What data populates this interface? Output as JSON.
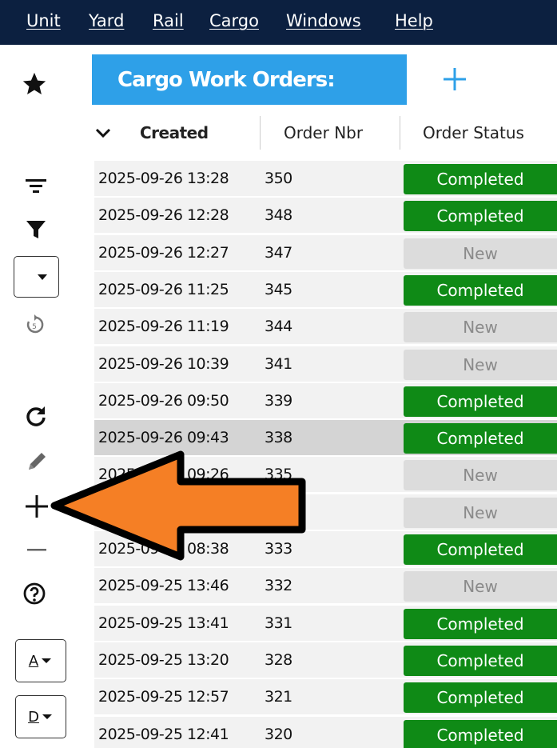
{
  "menu": [
    "Unit",
    "Yard",
    "Rail",
    "Cargo",
    "Windows",
    "Help"
  ],
  "toolbar": {
    "sort_a_label": "A",
    "sort_d_label": "D"
  },
  "title": "Cargo Work Orders:",
  "table": {
    "columns": [
      "Created",
      "Order Nbr",
      "Order Status"
    ],
    "rows": [
      {
        "created": "2025-09-26 13:28",
        "order_nbr": "350",
        "status": "Completed"
      },
      {
        "created": "2025-09-26 12:28",
        "order_nbr": "348",
        "status": "Completed"
      },
      {
        "created": "2025-09-26 12:27",
        "order_nbr": "347",
        "status": "New"
      },
      {
        "created": "2025-09-26 11:25",
        "order_nbr": "345",
        "status": "Completed"
      },
      {
        "created": "2025-09-26 11:19",
        "order_nbr": "344",
        "status": "New"
      },
      {
        "created": "2025-09-26 10:39",
        "order_nbr": "341",
        "status": "New"
      },
      {
        "created": "2025-09-26 09:50",
        "order_nbr": "339",
        "status": "Completed"
      },
      {
        "created": "2025-09-26 09:43",
        "order_nbr": "338",
        "status": "Completed"
      },
      {
        "created": "2025-09-26 09:26",
        "order_nbr": "335",
        "status": "New"
      },
      {
        "created": "",
        "order_nbr": "",
        "status": "New"
      },
      {
        "created": "2025-09-26 08:38",
        "order_nbr": "333",
        "status": "Completed"
      },
      {
        "created": "2025-09-25 13:46",
        "order_nbr": "332",
        "status": "New"
      },
      {
        "created": "2025-09-25 13:41",
        "order_nbr": "331",
        "status": "Completed"
      },
      {
        "created": "2025-09-25 13:20",
        "order_nbr": "328",
        "status": "Completed"
      },
      {
        "created": "2025-09-25 12:57",
        "order_nbr": "321",
        "status": "Completed"
      },
      {
        "created": "2025-09-25 12:41",
        "order_nbr": "320",
        "status": "Completed"
      }
    ]
  },
  "selected_row": 7,
  "colors": {
    "menubar": "#0c2040",
    "title_tab": "#2ea0e8",
    "completed": "#0f8a16",
    "new": "#dcdcdc",
    "arrow": "#f57f25"
  },
  "icons": [
    "star-icon",
    "sort-lines-icon",
    "funnel-icon",
    "dropdown-icon",
    "restore-icon",
    "refresh-icon",
    "pencil-icon",
    "plus-icon",
    "minus-icon",
    "help-icon",
    "chevron-down-icon",
    "arrow-icon"
  ]
}
